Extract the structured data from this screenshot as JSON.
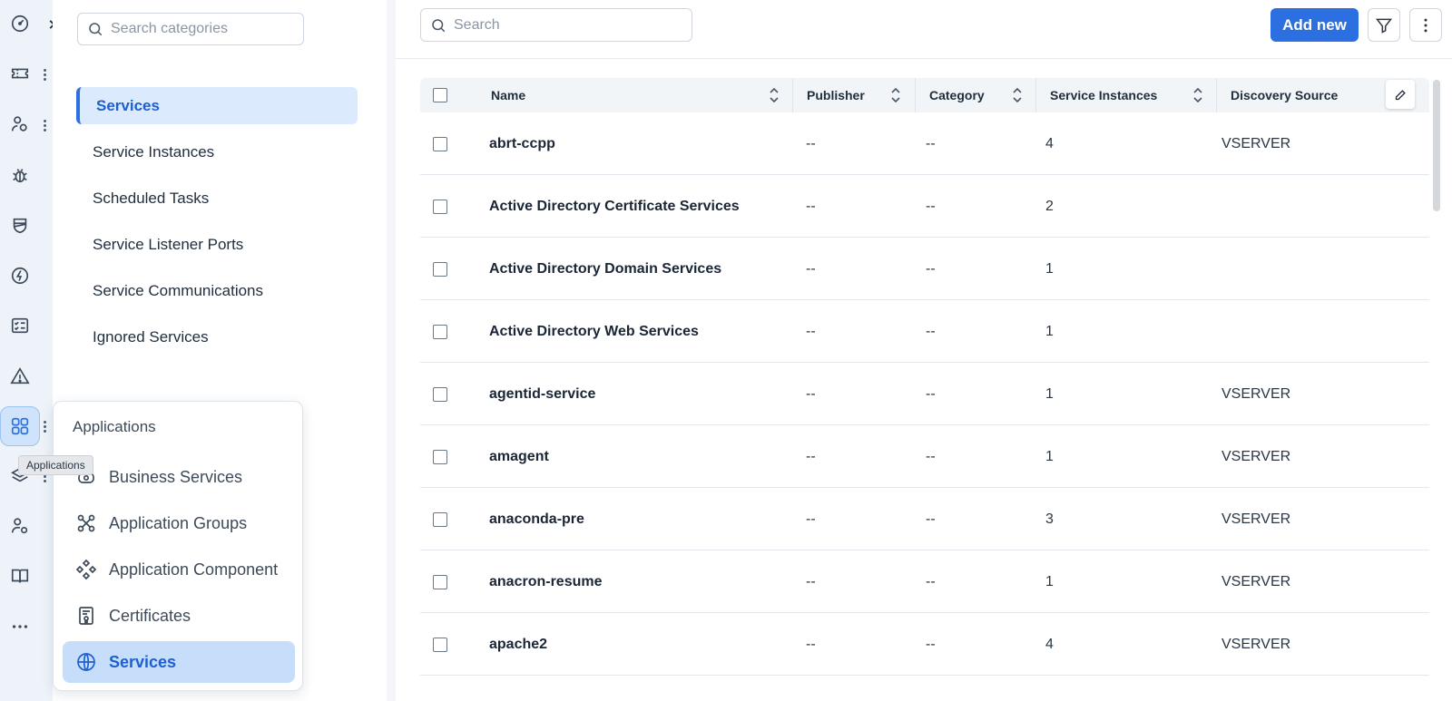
{
  "rail": {
    "items": [
      {
        "icon": "gauge-icon"
      },
      {
        "icon": "ticket-icon"
      },
      {
        "icon": "user-settings-icon"
      },
      {
        "icon": "bug-icon"
      },
      {
        "icon": "shield-icon"
      },
      {
        "icon": "bolt-icon"
      },
      {
        "icon": "checklist-icon"
      },
      {
        "icon": "warning-icon"
      },
      {
        "icon": "grid-icon"
      },
      {
        "icon": "layers-icon"
      },
      {
        "icon": "user-network-icon"
      },
      {
        "icon": "book-icon"
      },
      {
        "icon": "more-icon"
      }
    ],
    "active_tooltip": "Applications"
  },
  "categories": {
    "search_placeholder": "Search categories",
    "items": [
      {
        "label": "Services",
        "active": true
      },
      {
        "label": "Service Instances"
      },
      {
        "label": "Scheduled Tasks"
      },
      {
        "label": "Service Listener Ports"
      },
      {
        "label": "Service Communications"
      },
      {
        "label": "Ignored Services"
      }
    ]
  },
  "toolbar": {
    "search_placeholder": "Search",
    "add_label": "Add new"
  },
  "table": {
    "columns": [
      "Name",
      "Publisher",
      "Category",
      "Service Instances",
      "Discovery Source"
    ],
    "rows": [
      {
        "name": "abrt-ccpp",
        "publisher": "--",
        "category": "--",
        "instances": "4",
        "source": "VSERVER"
      },
      {
        "name": "Active Directory Certificate Services",
        "publisher": "--",
        "category": "--",
        "instances": "2",
        "source": ""
      },
      {
        "name": "Active Directory Domain Services",
        "publisher": "--",
        "category": "--",
        "instances": "1",
        "source": ""
      },
      {
        "name": "Active Directory Web Services",
        "publisher": "--",
        "category": "--",
        "instances": "1",
        "source": ""
      },
      {
        "name": "agentid-service",
        "publisher": "--",
        "category": "--",
        "instances": "1",
        "source": "VSERVER"
      },
      {
        "name": "amagent",
        "publisher": "--",
        "category": "--",
        "instances": "1",
        "source": "VSERVER"
      },
      {
        "name": "anaconda-pre",
        "publisher": "--",
        "category": "--",
        "instances": "3",
        "source": "VSERVER"
      },
      {
        "name": "anacron-resume",
        "publisher": "--",
        "category": "--",
        "instances": "1",
        "source": "VSERVER"
      },
      {
        "name": "apache2",
        "publisher": "--",
        "category": "--",
        "instances": "4",
        "source": "VSERVER"
      }
    ]
  },
  "flyout": {
    "title": "Applications",
    "items": [
      {
        "label": "Business Services",
        "icon": "business-services-icon"
      },
      {
        "label": "Application Groups",
        "icon": "app-groups-icon"
      },
      {
        "label": "Application Component",
        "icon": "app-component-icon"
      },
      {
        "label": "Certificates",
        "icon": "certificate-icon"
      },
      {
        "label": "Services",
        "icon": "globe-icon",
        "active": true
      }
    ]
  },
  "colors": {
    "accent": "#2b6fe0",
    "rail_bg": "#eef3f9",
    "active_bg": "#dbeafd"
  }
}
